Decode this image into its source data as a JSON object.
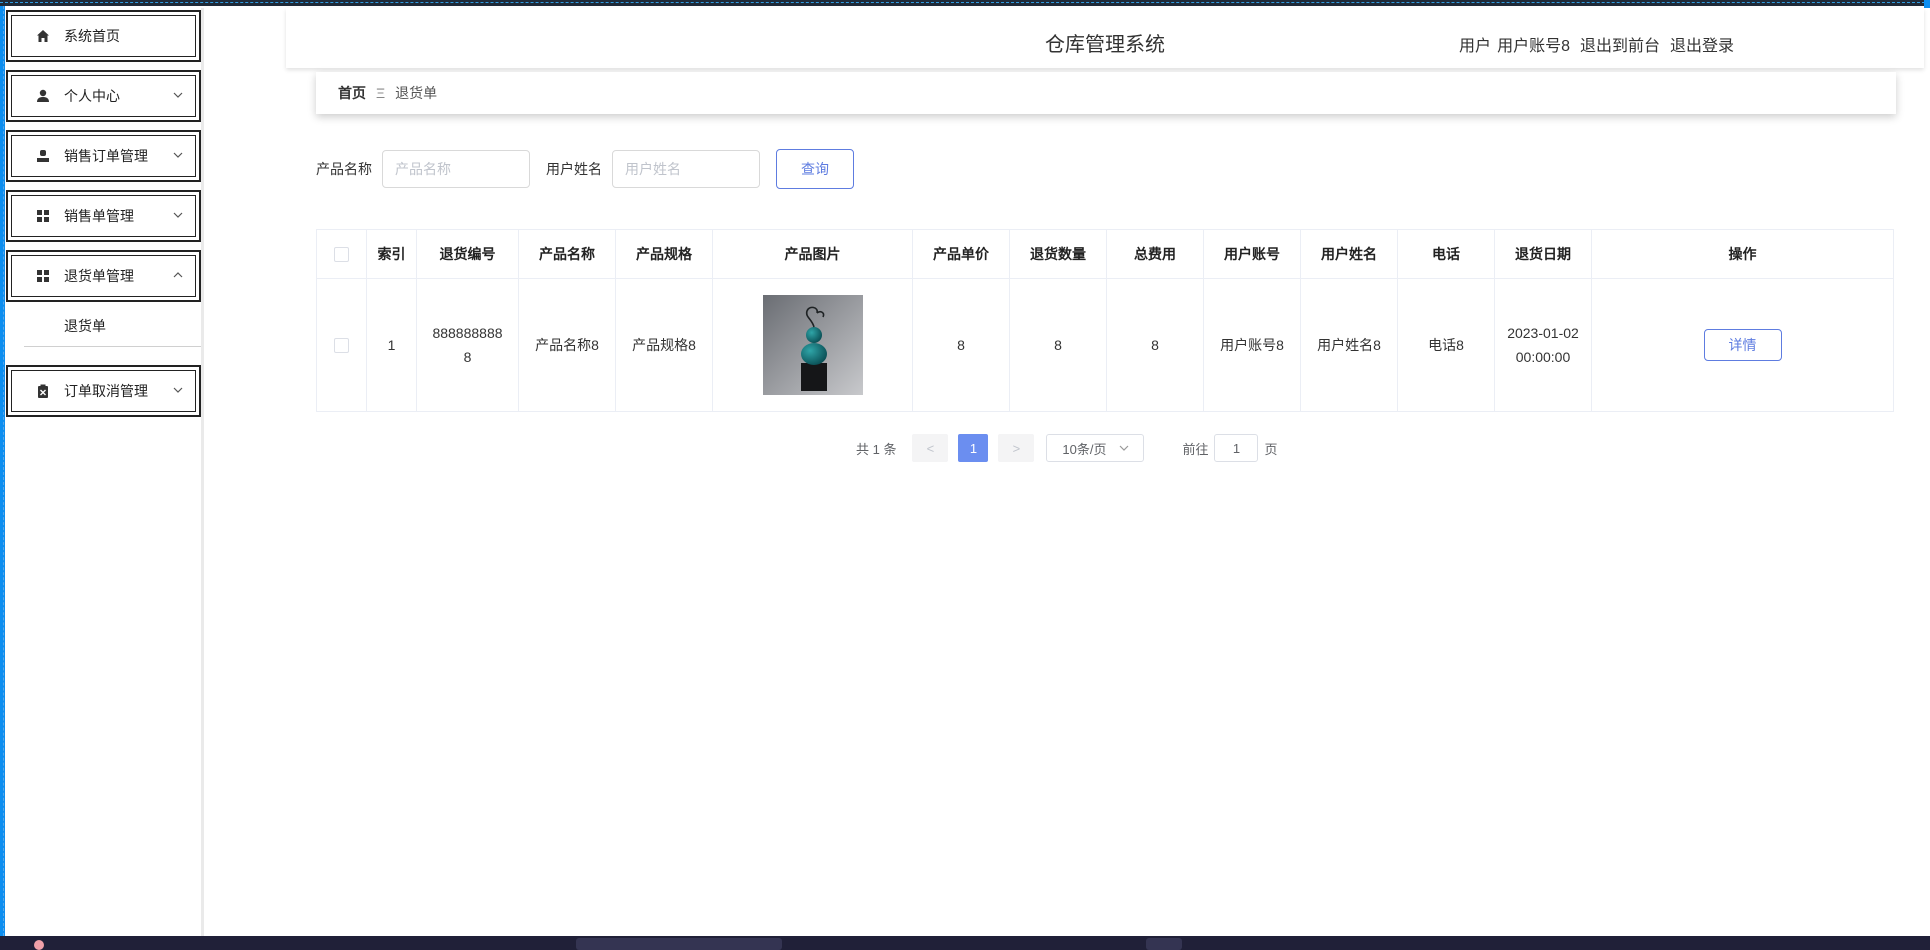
{
  "header": {
    "title": "仓库管理系统",
    "user_role": "用户",
    "user_name": "用户账号8",
    "back_to_front": "退出到前台",
    "logout": "退出登录"
  },
  "sidebar": {
    "items": [
      {
        "label": "系统首页",
        "icon": "home-icon"
      },
      {
        "label": "个人中心",
        "icon": "user-icon"
      },
      {
        "label": "销售订单管理",
        "icon": "person-icon"
      },
      {
        "label": "销售单管理",
        "icon": "grid-icon"
      },
      {
        "label": "退货单管理",
        "icon": "grid-icon"
      },
      {
        "label": "订单取消管理",
        "icon": "clipboard-x-icon"
      }
    ],
    "submenu": {
      "label": "退货单"
    }
  },
  "breadcrumb": {
    "home": "首页",
    "separator": "Ξ",
    "current": "退货单"
  },
  "search": {
    "product_label": "产品名称",
    "product_placeholder": "产品名称",
    "user_label": "用户姓名",
    "user_placeholder": "用户姓名",
    "button": "查询"
  },
  "table": {
    "headers": [
      "索引",
      "退货编号",
      "产品名称",
      "产品规格",
      "产品图片",
      "产品单价",
      "退货数量",
      "总费用",
      "用户账号",
      "用户姓名",
      "电话",
      "退货日期",
      "操作"
    ],
    "rows": [
      {
        "index": "1",
        "return_no": "8888888888",
        "product_name": "产品名称8",
        "product_spec": "产品规格8",
        "unit_price": "8",
        "quantity": "8",
        "total": "8",
        "account": "用户账号8",
        "user_name": "用户姓名8",
        "phone": "电话8",
        "date": "2023-01-02 00:00:00",
        "action": "详情"
      }
    ]
  },
  "pagination": {
    "total": "共 1 条",
    "prev": "<",
    "current": "1",
    "next": ">",
    "page_size": "10条/页",
    "goto_label": "前往",
    "goto_value": "1",
    "page_unit": "页"
  },
  "colors": {
    "accent": "#5e7ce0",
    "active_page": "#6b8ef0",
    "frame_blue": "#0d8ef0"
  }
}
